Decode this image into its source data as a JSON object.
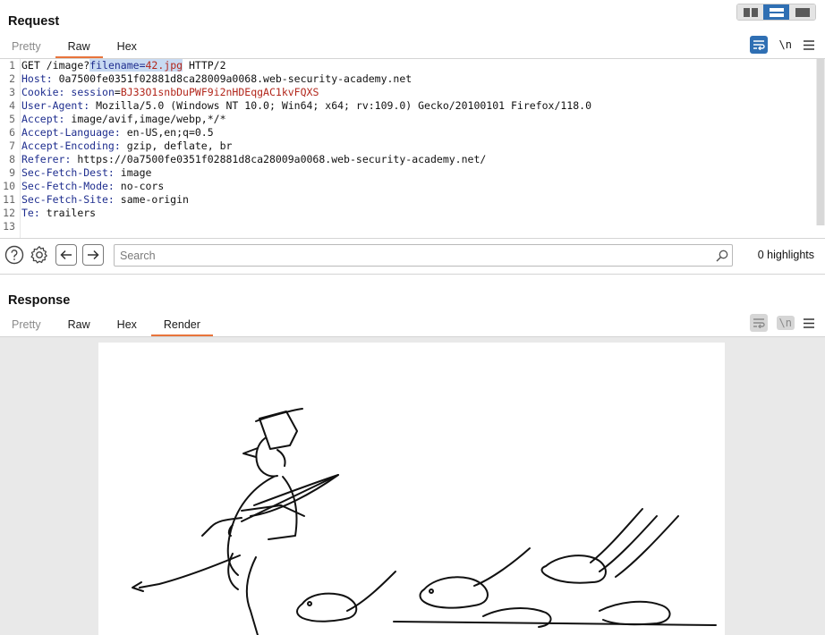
{
  "request": {
    "title": "Request",
    "tabs": [
      "Pretty",
      "Raw",
      "Hex"
    ],
    "active_tab": "Raw",
    "newline_label": "\\n",
    "lines": [
      {
        "num": "1",
        "method": "GET",
        "path": "/image?",
        "param_name": "filename=",
        "param_value": "42.jpg",
        "protocol": "HTTP/2"
      },
      {
        "num": "2",
        "name": "Host:",
        "value": "0a7500fe0351f02881d8ca28009a0068.web-security-academy.net"
      },
      {
        "num": "3",
        "name": "Cookie:",
        "cookie_name": "session",
        "value": "BJ33O1snbDuPWF9i2nHDEqgAC1kvFQXS"
      },
      {
        "num": "4",
        "name": "User-Agent:",
        "value": "Mozilla/5.0 (Windows NT 10.0; Win64; x64; rv:109.0) Gecko/20100101 Firefox/118.0"
      },
      {
        "num": "5",
        "name": "Accept:",
        "value": "image/avif,image/webp,*/*"
      },
      {
        "num": "6",
        "name": "Accept-Language:",
        "value": "en-US,en;q=0.5"
      },
      {
        "num": "7",
        "name": "Accept-Encoding:",
        "value": "gzip, deflate, br"
      },
      {
        "num": "8",
        "name": "Referer:",
        "value": "https://0a7500fe0351f02881d8ca28009a0068.web-security-academy.net/"
      },
      {
        "num": "9",
        "name": "Sec-Fetch-Dest:",
        "value": "image"
      },
      {
        "num": "10",
        "name": "Sec-Fetch-Mode:",
        "value": "no-cors"
      },
      {
        "num": "11",
        "name": "Sec-Fetch-Site:",
        "value": "same-origin"
      },
      {
        "num": "12",
        "name": "Te:",
        "value": "trailers"
      },
      {
        "num": "13",
        "name": "",
        "value": ""
      }
    ]
  },
  "search": {
    "placeholder": "Search",
    "value": "",
    "highlights": "0 highlights"
  },
  "response": {
    "title": "Response",
    "tabs": [
      "Pretty",
      "Raw",
      "Hex",
      "Render"
    ],
    "active_tab": "Render",
    "newline_label": "\\n"
  },
  "icons": {
    "help": "help-circle-icon",
    "settings": "gear-icon",
    "back": "arrow-left-icon",
    "forward": "arrow-right-icon",
    "search": "search-icon",
    "wrap": "word-wrap-icon",
    "menu": "hamburger-menu-icon"
  },
  "colors": {
    "accent": "#e8743b",
    "toggle_active": "#2f6fb3",
    "header_name": "#1f2e8f",
    "value_red": "#b2261b"
  }
}
